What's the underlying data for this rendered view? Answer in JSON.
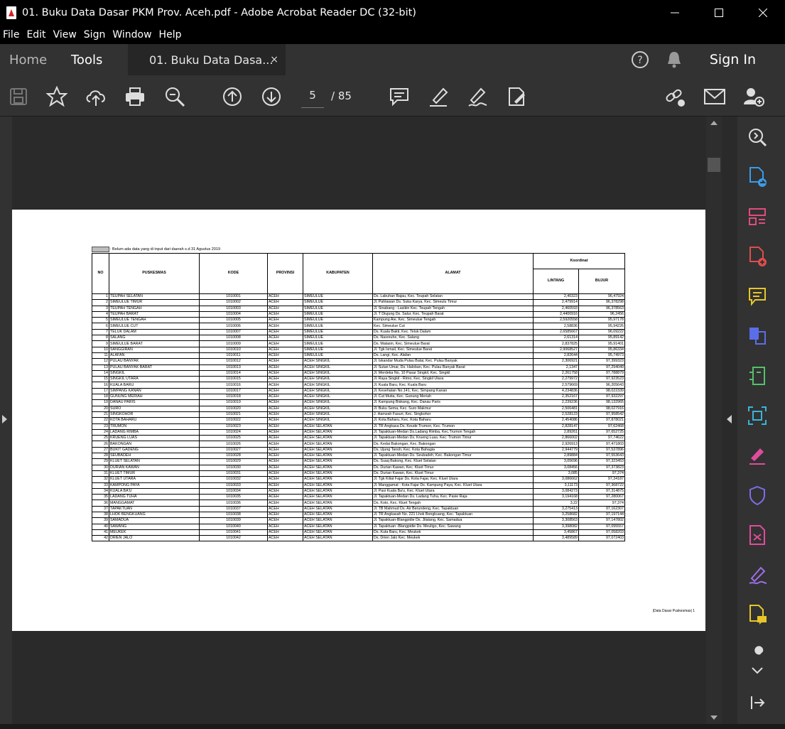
{
  "window": {
    "title": "01. Buku Data Dasar PKM Prov. Aceh.pdf - Adobe Acrobat Reader DC (32-bit)"
  },
  "menu": [
    "File",
    "Edit",
    "View",
    "Sign",
    "Window",
    "Help"
  ],
  "tabs": {
    "home": "Home",
    "tools": "Tools",
    "document": "01. Buku Data Dasa...",
    "close": "×",
    "sign_in": "Sign In"
  },
  "toolbar": {
    "page_current": "5",
    "page_total": "/ 85"
  },
  "icons": {
    "toolbar": [
      "save-icon",
      "bookmark-star-icon",
      "upload-cloud-icon",
      "print-icon",
      "zoom-search-icon",
      "page-up-icon",
      "page-down-icon",
      "comment-icon",
      "highlight-pen-icon",
      "fill-sign-icon",
      "edit-pdf-icon",
      "share-link-icon",
      "email-icon",
      "add-user-icon"
    ],
    "right_panel": [
      "zoom-tool-icon",
      "export-pdf-icon",
      "organize-pages-icon",
      "create-pdf-icon",
      "comment-tool-icon",
      "combine-files-icon",
      "compress-icon",
      "scan-icon",
      "fill-sign-tool-icon",
      "protect-icon",
      "redact-icon",
      "sign-icon",
      "send-comments-icon",
      "more-tools-icon",
      "collapse-panel-icon"
    ]
  },
  "colors": {
    "background": "#1e1e1e",
    "panel": "#323232",
    "accent_tools": "#e8a628"
  },
  "document": {
    "legend": ": Belum ada data yang di input dari daerah s.d 31 Agustus 2019",
    "headers": {
      "no": "NO",
      "puskesmas": "PUSKESMAS",
      "kode": "KODE",
      "provinsi": "PROVINSI",
      "kabupaten": "KABUPATEN",
      "alamat": "ALAMAT",
      "koordinat": "Koordinat",
      "lintang": "LINTANG",
      "bujur": "BUJUR"
    },
    "footer": "|Data Dasar Puskesmas| 1",
    "rows": [
      [
        "1",
        "TEUPAH SELATAN",
        "1010001",
        "ACEH",
        "SIMEULUE",
        "Ds. Labuhan Bajau, Kec. Teupah Selatan",
        "2,40323",
        "96,47924"
      ],
      [
        "2",
        "SIMEULUE TIMUR",
        "1010002",
        "ACEH",
        "SIMEULUE",
        "Jl. Pahlawan Ds. Suka Karya,  Kec. Simeulu Timur",
        "2,479914",
        "96,378298"
      ],
      [
        "3",
        "TEUPAH TENGAH",
        "1010003",
        "ACEH",
        "SIMEULUE",
        "Jl. Sinabang - Lasikin Kec. Teupah Tengah",
        "2,460593",
        "96,378563"
      ],
      [
        "4",
        "TEUPAH BARAT",
        "1010004",
        "ACEH",
        "SIMEULUE",
        "Jl. T Diujung Ds. Salur, Kec. Teupah Barat",
        "2,4400916",
        "96,2456"
      ],
      [
        "5",
        "SIMEULUE TENGAH",
        "1010005",
        "ACEH",
        "SIMEULUE",
        "Kampung Aie, Kec. Simeulue Tengah",
        "2,5920558",
        "95,97178"
      ],
      [
        "6",
        "SIMEULUE CUT",
        "1010006",
        "ACEH",
        "SIMEULUE",
        "Kec. Simeulue Cut",
        "2,58836",
        "95,94226"
      ],
      [
        "7",
        "TELUK DALAM",
        "1010007",
        "ACEH",
        "SIMEULUE",
        "Ds. Kuala Bakti, Kec. Teluk Dalam",
        "2,6585667",
        "96,09222"
      ],
      [
        "8",
        "SALANG",
        "1010008",
        "ACEH",
        "SIMEULUE",
        "Ds. Nasreuhe, Kec. Salang",
        "2,61314",
        "95,89142"
      ],
      [
        "9",
        "SIMEULUE BARAT",
        "1010009",
        "ACEH",
        "SIMEULUE",
        "Ds. Malasin, Kec. Simeulue Barat",
        "2,837825",
        "95,91401"
      ],
      [
        "10",
        "SANGGIRAN",
        "1010010",
        "ACEH",
        "SIMEULUE",
        "Jl. Tgk Ismail, Kec. Simeulue Barat",
        "2,9068527",
        "95,86334"
      ],
      [
        "11",
        "ALAFAN",
        "1010011",
        "ACEH",
        "SIMEULUE",
        "Ds. Langi, Kec. Alafan",
        "2,82644",
        "95,74973"
      ],
      [
        "12",
        "PULAU BANYAK",
        "1010012",
        "ACEH",
        "ACEH SINGKIL",
        "Jl. Iskandar Muda Pulau Balai, Kec. Pulau Banyak",
        "2,306921",
        "97,399323"
      ],
      [
        "13",
        "PULAU BANYAK BARAT",
        "1010013",
        "ACEH",
        "ACEH SINGKIL",
        "Jl. Sutan Umar, Ds. Haloban, Kec. Pulau Banyak Barat",
        "2,1347",
        "97,294049"
      ],
      [
        "14",
        "SINGKIL",
        "1010014",
        "ACEH",
        "ACEH SINGKIL",
        "Jl. Merdeka No, 10 Pasar Singkil, Kec. Singkil",
        "2,261758",
        "97,788879"
      ],
      [
        "15",
        "SINGKIL UTARA",
        "1010015",
        "ACEH",
        "ACEH SINGKIL",
        "Jl. Raya Singkil - Rimo, Kec. Singkil Utara",
        "2,279972",
        "97,923523"
      ],
      [
        "16",
        "KUALA BARU",
        "1010016",
        "ACEH",
        "ACEH SINGKIL",
        "Jl. Kuala Baru, Kec. Kuala Baru",
        "2,579669",
        "96,205643"
      ],
      [
        "17",
        "SIMPANG KANAN",
        "1010017",
        "ACEH",
        "ACEH SINGKIL",
        "Jl. Kesehatan No.141, Kec. Simpang Kanan",
        "4,234836",
        "98,022339"
      ],
      [
        "18",
        "GUNUNG MERIAH",
        "1010018",
        "ACEH",
        "ACEH SINGKIL",
        "Jl. Cut Mutia, Kec. Gunung Meriah",
        "2,352167",
        "97,932297"
      ],
      [
        "19",
        "DANAU PARIS",
        "1010019",
        "ACEH",
        "ACEH SINGKIL",
        "Jl. Kampung Biskang, Kec. Danau Paris",
        "2,239236",
        "98,132965"
      ],
      [
        "20",
        "SURO",
        "1010020",
        "ACEH",
        "ACEH SINGKIL",
        "Jl. Buku Sema, Kec. Suro Makmur",
        "2,506481",
        "98,027916"
      ],
      [
        "21",
        "SINGKOHOR",
        "1010021",
        "ACEH",
        "ACEH SINGKIL",
        "J. Hamzah Fasuri, Kec. Singkohor",
        "2,528123",
        "97,958542"
      ],
      [
        "22",
        "KOTA BAHARU",
        "1010022",
        "ACEH",
        "ACEH SINGKIL",
        "Jl. Kota Baharu, Kec. Kota Baharu",
        "2,454086",
        "97,878021"
      ],
      [
        "23",
        "TRUMON",
        "1010023",
        "ACEH",
        "ACEH SELATAN",
        "Jl. TR Angkasa Ds. Keude Trumon, Kec. Trumon",
        "2,828147",
        "97,62468"
      ],
      [
        "24",
        "LADANG RIMBA",
        "1010024",
        "ACEH",
        "ACEH SELATAN",
        "Jl. Tapaktuan-Medan Ds.Ladang Rimba, Kec.Trumon Tengah",
        "2,89261",
        "97,652725"
      ],
      [
        "25",
        "KRUENG LUAS",
        "1010025",
        "ACEH",
        "ACEH SELATAN",
        "Jl. Tapaktuan-Medan Ds. Krueng Luas, Kec. Trumon Timur",
        "2,866002",
        "97,74622"
      ],
      [
        "26",
        "BAKONGAN",
        "1010026",
        "ACEH",
        "ACEH SELATAN",
        "Ds. Kedai Bakongan, Kec. Bakongan",
        "2,926913",
        "97,471803"
      ],
      [
        "27",
        "BUKIT GADENG",
        "1010027",
        "ACEH",
        "ACEH SELATAN",
        "Ds. Ujung Tanoh, Kec. Kota Bahagia",
        "2,944779",
        "97,537896"
      ],
      [
        "28",
        "SEUBADEH",
        "1010028",
        "ACEH",
        "ACEH SELATAN",
        "Jl. Tapaktuan-Medan Ds. Seubadeh, Kec. Bakongan Timur",
        "2,89884",
        "97,553643"
      ],
      [
        "29",
        "KLUET SELATAN",
        "1010029",
        "ACEH",
        "ACEH SELATAN",
        "Ds. Suaq Bakong, Kec. Kluet Selatan",
        "3,05696",
        "97,323453"
      ],
      [
        "30",
        "DURIAN KAWAN",
        "1010030",
        "ACEH",
        "ACEH SELATAN",
        "Ds. Durian Kawan, Kec. Kluet Timur",
        "3,08456",
        "97,373823"
      ],
      [
        "31",
        "KLUET TIMUR",
        "1010031",
        "ACEH",
        "ACEH SELATAN",
        "Ds. Durian Kawan, Kec. Kluet Timur",
        "3,085",
        "97,374"
      ],
      [
        "32",
        "KLUET UTARA",
        "1010032",
        "ACEH",
        "ACEH SELATAN",
        "Jl. Tgk Kiliat Fajar Ds. Kota Fajar, Kec. Kluet Utara",
        "3,086662",
        "97,34187"
      ],
      [
        "33",
        "KAMPONG PAYA",
        "1010033",
        "ACEH",
        "ACEH SELATAN",
        "Jl. Manggamat - Kota Fajar Ds. Kampung Paya, Kec. Kluet Utara",
        "3,11173",
        "97,368722"
      ],
      [
        "34",
        "KUALA BA'U",
        "1010034",
        "ACEH",
        "ACEH SELATAN",
        "Jl. Pasi Kuala Ba'u, Kec. Kluet Utara",
        "3,084273",
        "97,314875"
      ],
      [
        "35",
        "LADANG TUHA",
        "1010035",
        "ACEH",
        "ACEH SELATAN",
        "Jl. Tapaktuan-Medan Ds. Ladang Tuha, Kec. Pasie Raja",
        "3,194168",
        "97,280067"
      ],
      [
        "36",
        "MANGGAMAT",
        "1010036",
        "ACEH",
        "ACEH SELATAN",
        "Ds. Koto, Kec. Kluet Tengah",
        "3,22",
        "97,374"
      ],
      [
        "37",
        "TAPAKTUAN",
        "1010037",
        "ACEH",
        "ACEH SELATAN",
        "Jl. TB Mahmud Ds. Air Berundeng, Kec. Tapaktuan",
        "3,275413",
        "97,162307"
      ],
      [
        "38",
        "LHOK BENGKUANG",
        "1010038",
        "ACEH",
        "ACEH SELATAN",
        "Jl. TR Angkasah No. 221 Lhok Bengkuang, Kec. Tapaktuan",
        "3,258682",
        "97,197144"
      ],
      [
        "39",
        "SAMADUA",
        "1010039",
        "ACEH",
        "ACEH SELATAN",
        "Jl. Tapaktuan-Blangpidie Ds. Jilatang, Kec. Samadua",
        "3,308563",
        "97,147802"
      ],
      [
        "40",
        "SAWANG",
        "1010040",
        "ACEH",
        "ACEH SELATAN",
        "Jl. Tapaktuan -Blangpidie Ds. Meuligo, Kec. Sawang",
        "3,398082",
        "97,095557"
      ],
      [
        "41",
        "MEUKEK",
        "1010041",
        "ACEH",
        "ACEH SELATAN",
        "Ds. Kuta Baru, Kec. Meukek",
        "3,45867",
        "97,058203"
      ],
      [
        "42",
        "DRIEN JALO",
        "1010042",
        "ACEH",
        "ACEH SELATAN",
        "Ds. Drien Jalo Kec. Meukek",
        "3,489589",
        "97,072403"
      ]
    ]
  }
}
